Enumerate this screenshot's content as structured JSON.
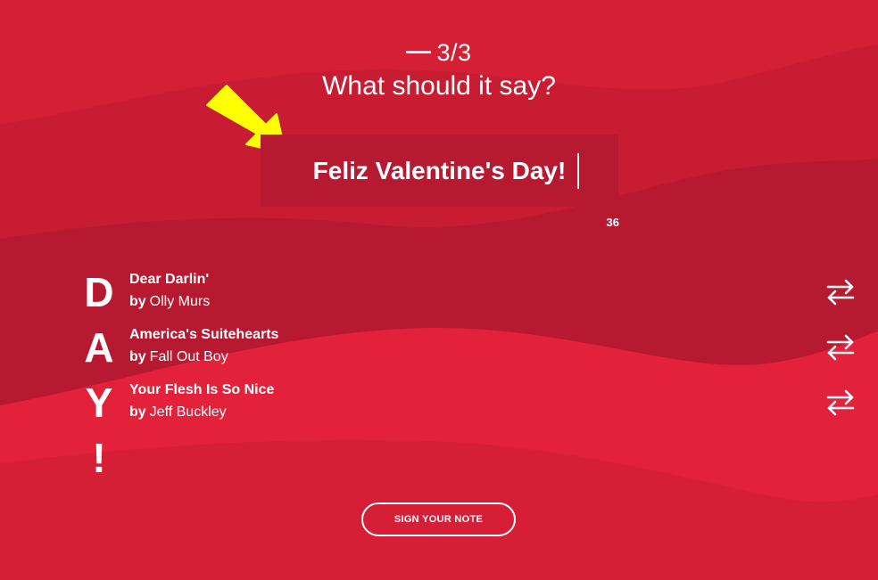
{
  "header": {
    "step": "3/3",
    "question": "What should it say?"
  },
  "message": {
    "value": "Feliz Valentine's Day!",
    "char_count": "36"
  },
  "acrostic": {
    "letters": [
      "D",
      "A",
      "Y",
      "!"
    ]
  },
  "tracks": [
    {
      "title": "Dear Darlin'",
      "by": "by",
      "artist": "Olly Murs"
    },
    {
      "title": "America's Suitehearts",
      "by": "by",
      "artist": "Fall Out Boy"
    },
    {
      "title": "Your Flesh Is So Nice",
      "by": "by",
      "artist": "Jeff Buckley"
    }
  ],
  "actions": {
    "sign_label": "SIGN YOUR NOTE",
    "swap_icon": "swap-arrows-icon"
  },
  "colors": {
    "background": "#d41f35",
    "band_dark": "#b71a30",
    "band_light": "#e3213a",
    "arrow": "#ffff00"
  }
}
